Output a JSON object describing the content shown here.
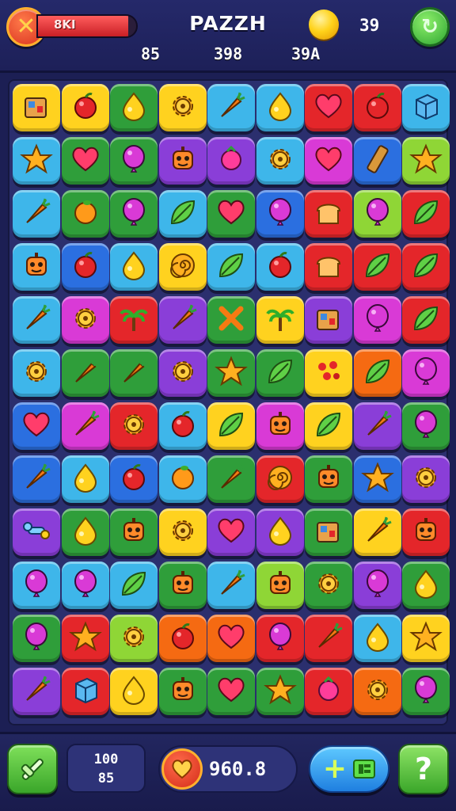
{
  "header": {
    "hp_label": "8KI",
    "hp_fraction": 0.92,
    "title": "PAZZH",
    "coins": "39",
    "stats": [
      "85",
      "398",
      "39A"
    ]
  },
  "board": {
    "cols": 9,
    "rows": 12,
    "tiles": [
      [
        "yellow",
        "box"
      ],
      [
        "yellow",
        "apple"
      ],
      [
        "green",
        "drop"
      ],
      [
        "yellow",
        "gear"
      ],
      [
        "sky",
        "carrot"
      ],
      [
        "sky",
        "drop"
      ],
      [
        "red",
        "heart"
      ],
      [
        "red",
        "apple"
      ],
      [
        "sky",
        "cube"
      ],
      [
        "sky",
        "star"
      ],
      [
        "green",
        "heart"
      ],
      [
        "green",
        "balloon"
      ],
      [
        "purple",
        "robot"
      ],
      [
        "purple",
        "berry"
      ],
      [
        "sky",
        "gear"
      ],
      [
        "pink",
        "heart"
      ],
      [
        "blue",
        "log"
      ],
      [
        "lime",
        "star"
      ],
      [
        "sky",
        "carrot"
      ],
      [
        "green",
        "orange"
      ],
      [
        "green",
        "balloon"
      ],
      [
        "sky",
        "leaf"
      ],
      [
        "green",
        "heart"
      ],
      [
        "blue",
        "balloon"
      ],
      [
        "red",
        "bread"
      ],
      [
        "lime",
        "balloon"
      ],
      [
        "red",
        "leaf"
      ],
      [
        "sky",
        "robot"
      ],
      [
        "blue",
        "apple"
      ],
      [
        "sky",
        "drop"
      ],
      [
        "yellow",
        "swirl"
      ],
      [
        "sky",
        "leaf"
      ],
      [
        "sky",
        "apple"
      ],
      [
        "red",
        "bread"
      ],
      [
        "red",
        "leaf"
      ],
      [
        "red",
        "leaf"
      ],
      [
        "sky",
        "carrot"
      ],
      [
        "pink",
        "gear"
      ],
      [
        "red",
        "palm"
      ],
      [
        "purple",
        "carrot"
      ],
      [
        "green",
        "cross"
      ],
      [
        "yellow",
        "palm"
      ],
      [
        "purple",
        "box"
      ],
      [
        "pink",
        "balloon"
      ],
      [
        "red",
        "leaf"
      ],
      [
        "sky",
        "gear"
      ],
      [
        "green",
        "carrot"
      ],
      [
        "green",
        "carrot"
      ],
      [
        "purple",
        "gear"
      ],
      [
        "green",
        "star"
      ],
      [
        "green",
        "leaf"
      ],
      [
        "yellow",
        "berries"
      ],
      [
        "orange",
        "leaf"
      ],
      [
        "pink",
        "balloon"
      ],
      [
        "blue",
        "heart"
      ],
      [
        "pink",
        "carrot"
      ],
      [
        "red",
        "gear"
      ],
      [
        "sky",
        "apple"
      ],
      [
        "yellow",
        "leaf"
      ],
      [
        "pink",
        "robot"
      ],
      [
        "yellow",
        "leaf"
      ],
      [
        "purple",
        "carrot"
      ],
      [
        "green",
        "balloon"
      ],
      [
        "blue",
        "carrot"
      ],
      [
        "sky",
        "drop"
      ],
      [
        "blue",
        "apple"
      ],
      [
        "sky",
        "orange"
      ],
      [
        "green",
        "carrot"
      ],
      [
        "red",
        "swirl"
      ],
      [
        "green",
        "robot"
      ],
      [
        "blue",
        "star"
      ],
      [
        "purple",
        "gear"
      ],
      [
        "purple",
        "bone"
      ],
      [
        "green",
        "drop"
      ],
      [
        "green",
        "robot"
      ],
      [
        "yellow",
        "gear"
      ],
      [
        "purple",
        "heart"
      ],
      [
        "purple",
        "drop"
      ],
      [
        "green",
        "box"
      ],
      [
        "yellow",
        "carrot"
      ],
      [
        "red",
        "robot"
      ],
      [
        "sky",
        "balloon"
      ],
      [
        "sky",
        "balloon"
      ],
      [
        "sky",
        "leaf"
      ],
      [
        "green",
        "robot"
      ],
      [
        "sky",
        "carrot"
      ],
      [
        "lime",
        "robot"
      ],
      [
        "green",
        "gear"
      ],
      [
        "purple",
        "balloon"
      ],
      [
        "green",
        "drop"
      ],
      [
        "green",
        "balloon"
      ],
      [
        "red",
        "star"
      ],
      [
        "lime",
        "gear"
      ],
      [
        "orange",
        "apple"
      ],
      [
        "orange",
        "heart"
      ],
      [
        "red",
        "balloon"
      ],
      [
        "red",
        "carrot"
      ],
      [
        "sky",
        "drop"
      ],
      [
        "yellow",
        "star"
      ],
      [
        "purple",
        "carrot"
      ],
      [
        "red",
        "cube"
      ],
      [
        "yellow",
        "drop"
      ],
      [
        "green",
        "robot"
      ],
      [
        "green",
        "heart"
      ],
      [
        "green",
        "star"
      ],
      [
        "red",
        "berry"
      ],
      [
        "orange",
        "gear"
      ],
      [
        "green",
        "balloon"
      ]
    ]
  },
  "footer": {
    "moves_top": "100",
    "moves_bottom": "85",
    "score": "960.8",
    "hammer_icon": "hammer-icon",
    "boost_icon": "add-booster-icon",
    "help_label": "?"
  },
  "palette": {
    "yellow": "#ffd21f",
    "red": "#e4262a",
    "green": "#2f9e3a",
    "sky": "#3eb6ea",
    "blue": "#2b6fe0",
    "purple": "#8a3ed8",
    "pink": "#d93ad6",
    "orange": "#f56a12",
    "lime": "#8fd636"
  }
}
